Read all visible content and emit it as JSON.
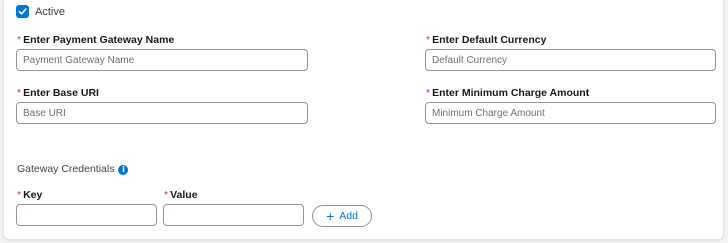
{
  "status": {
    "active_label": "Active",
    "active_checked": true
  },
  "fields": {
    "gateway_name": {
      "label": "Enter Payment Gateway Name",
      "placeholder": "Payment Gateway Name",
      "value": ""
    },
    "default_currency": {
      "label": "Enter Default Currency",
      "placeholder": "Default Currency",
      "value": ""
    },
    "base_uri": {
      "label": "Enter Base URI",
      "placeholder": "Base URI",
      "value": ""
    },
    "min_charge": {
      "label": "Enter Minimum Charge Amount",
      "placeholder": "Minimum Charge Amount",
      "value": ""
    }
  },
  "credentials": {
    "title": "Gateway Credentials",
    "info_icon_glyph": "i",
    "key_label": "Key",
    "value_label": "Value",
    "add_label": "Add",
    "add_glyph": "+"
  },
  "required_marker": "*",
  "colors": {
    "accent": "#0176d3",
    "required": "#c23934",
    "border": "#939393"
  }
}
